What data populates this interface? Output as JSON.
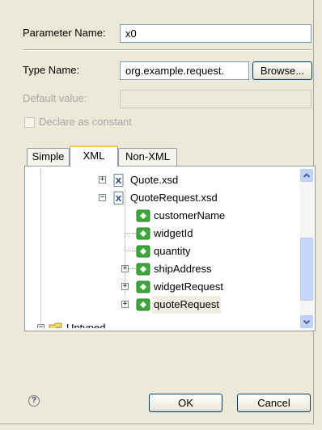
{
  "form": {
    "parameter_name_label": "Parameter Name:",
    "parameter_name_value": "x0",
    "type_name_label": "Type Name:",
    "type_name_value": "org.example.request.",
    "browse_label": "Browse...",
    "default_value_label": "Default value:",
    "default_value_value": "",
    "declare_constant_label": "Declare as constant",
    "declare_constant_checked": false
  },
  "tabs": [
    {
      "label": "Simple",
      "active": false
    },
    {
      "label": "XML",
      "active": true
    },
    {
      "label": "Non-XML",
      "active": false
    }
  ],
  "tree": {
    "items": [
      {
        "label": "Quote.xsd",
        "icon": "xsd-file-icon",
        "toggle": "+"
      },
      {
        "label": "QuoteRequest.xsd",
        "icon": "xsd-file-icon",
        "toggle": "-"
      },
      {
        "label": "customerName",
        "icon": "element-icon",
        "toggle": ""
      },
      {
        "label": "widgetId",
        "icon": "element-icon",
        "toggle": ""
      },
      {
        "label": "quantity",
        "icon": "element-icon",
        "toggle": ""
      },
      {
        "label": "shipAddress",
        "icon": "element-icon",
        "toggle": "+"
      },
      {
        "label": "widgetRequest",
        "icon": "element-icon",
        "toggle": "+"
      },
      {
        "label": "quoteRequest",
        "icon": "element-icon",
        "toggle": "+",
        "selected": true
      },
      {
        "label": "Untyped",
        "icon": "folder-icon",
        "toggle": "-"
      }
    ]
  },
  "footer": {
    "ok_label": "OK",
    "cancel_label": "Cancel",
    "help_symbol": "?"
  },
  "colors": {
    "dialog_bg": "#ece9d8",
    "active_tab_accent": "#ffc83c",
    "element_icon_green": "#3ea83a",
    "scrollbar_blue": "#c1d3fb"
  }
}
